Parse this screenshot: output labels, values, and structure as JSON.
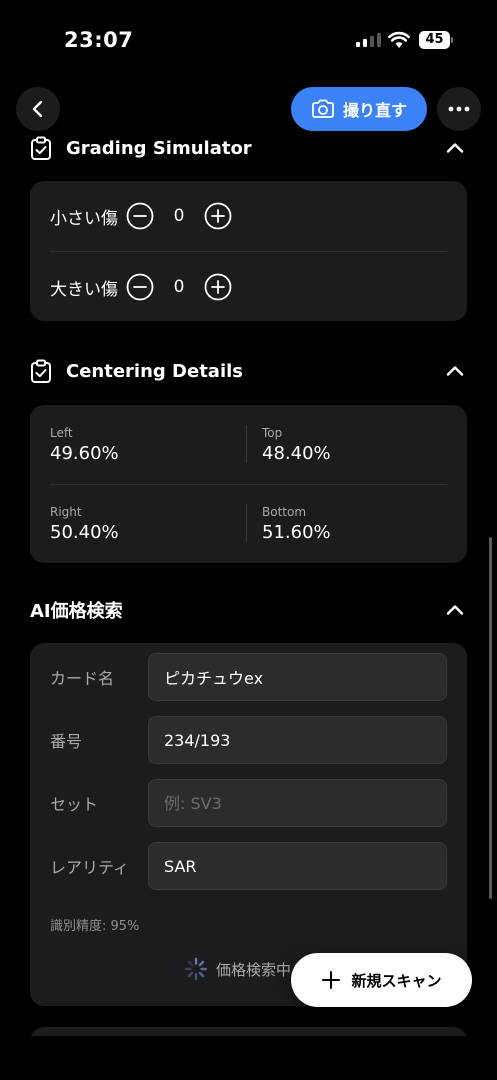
{
  "status_bar": {
    "time": "23:07",
    "battery": "45"
  },
  "nav": {
    "retake_label": "撮り直す"
  },
  "grading": {
    "title": "Grading Simulator",
    "rows": [
      {
        "label": "小さい傷",
        "value": "0"
      },
      {
        "label": "大きい傷",
        "value": "0"
      }
    ]
  },
  "centering": {
    "title": "Centering Details",
    "left": {
      "label": "Left",
      "value": "49.60%"
    },
    "top": {
      "label": "Top",
      "value": "48.40%"
    },
    "right": {
      "label": "Right",
      "value": "50.40%"
    },
    "bottom": {
      "label": "Bottom",
      "value": "51.60%"
    }
  },
  "price_search": {
    "title": "AI価格検索",
    "fields": [
      {
        "label": "カード名",
        "value": "ピカチュウex",
        "placeholder": ""
      },
      {
        "label": "番号",
        "value": "234/193",
        "placeholder": ""
      },
      {
        "label": "セット",
        "value": "",
        "placeholder": "例: SV3"
      },
      {
        "label": "レアリティ",
        "value": "SAR",
        "placeholder": ""
      }
    ],
    "accuracy": "識別精度: 95%",
    "searching": "価格検索中"
  },
  "fab": {
    "label": "新規スキャン"
  },
  "colors": {
    "accent": "#3b82f6",
    "card": "#1c1c1e",
    "background": "#000000"
  },
  "icons": [
    "back-icon",
    "camera-icon",
    "more-icon",
    "clipboard-check-icon",
    "chevron-up-icon",
    "minus-circle-icon",
    "plus-circle-icon",
    "spinner-icon",
    "plus-icon"
  ]
}
